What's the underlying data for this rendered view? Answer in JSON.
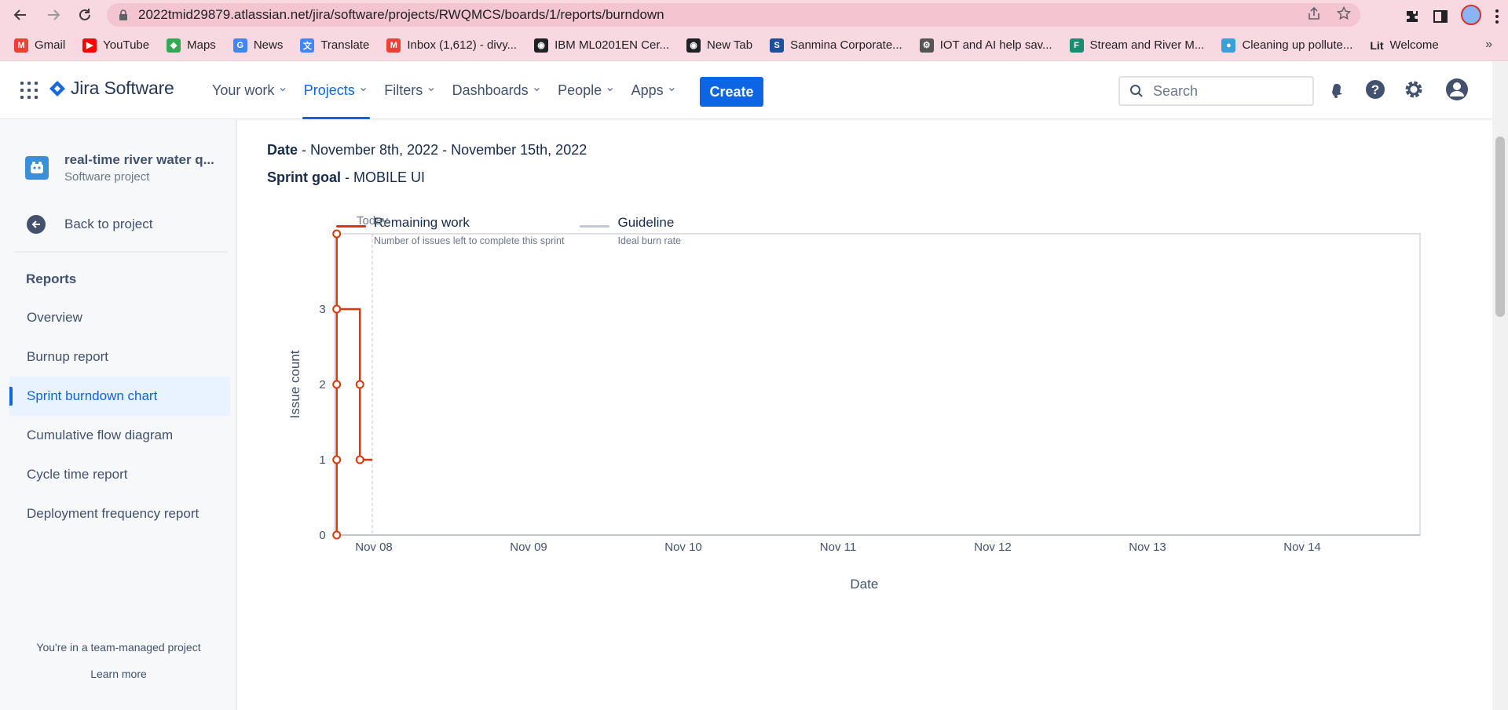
{
  "browser": {
    "url": "2022tmid29879.atlassian.net/jira/software/projects/RWQMCS/boards/1/reports/burndown",
    "bookmarks": [
      {
        "label": "Gmail",
        "color": "#ea4335",
        "glyph": "M"
      },
      {
        "label": "YouTube",
        "color": "#ff0000",
        "glyph": "▶"
      },
      {
        "label": "Maps",
        "color": "#34a853",
        "glyph": "◆"
      },
      {
        "label": "News",
        "color": "#4285f4",
        "glyph": "G"
      },
      {
        "label": "Translate",
        "color": "#4285f4",
        "glyph": "文"
      },
      {
        "label": "Inbox (1,612) - divy...",
        "color": "#ea4335",
        "glyph": "M"
      },
      {
        "label": "IBM ML0201EN Cer...",
        "color": "#202124",
        "glyph": "◉"
      },
      {
        "label": "New Tab",
        "color": "#202124",
        "glyph": "◉"
      },
      {
        "label": "Sanmina Corporate...",
        "color": "#1f4e9c",
        "glyph": "S"
      },
      {
        "label": "IOT and AI help sav...",
        "color": "#555555",
        "glyph": "⚙"
      },
      {
        "label": "Stream and River M...",
        "color": "#1a8c6f",
        "glyph": "F"
      },
      {
        "label": "Cleaning up pollute...",
        "color": "#3aa0d8",
        "glyph": "●"
      },
      {
        "label": "Welcome",
        "color": "#202124",
        "glyph": "Lit"
      }
    ]
  },
  "nav": {
    "product": "Jira Software",
    "menu": [
      {
        "label": "Your work",
        "active": false
      },
      {
        "label": "Projects",
        "active": true
      },
      {
        "label": "Filters",
        "active": false
      },
      {
        "label": "Dashboards",
        "active": false
      },
      {
        "label": "People",
        "active": false
      },
      {
        "label": "Apps",
        "active": false
      }
    ],
    "create_label": "Create",
    "search_placeholder": "Search"
  },
  "sidebar": {
    "project_name": "real-time river water q...",
    "project_type": "Software project",
    "back_label": "Back to project",
    "section_title": "Reports",
    "items": [
      {
        "label": "Overview",
        "active": false
      },
      {
        "label": "Burnup report",
        "active": false
      },
      {
        "label": "Sprint burndown chart",
        "active": true
      },
      {
        "label": "Cumulative flow diagram",
        "active": false
      },
      {
        "label": "Cycle time report",
        "active": false
      },
      {
        "label": "Deployment frequency report",
        "active": false
      }
    ],
    "team_note": "You're in a team-managed project",
    "learn_more": "Learn more"
  },
  "report": {
    "date_label": "Date",
    "date_value": "November 8th, 2022 - November 15th, 2022",
    "goal_label": "Sprint goal",
    "goal_value": "MOBILE UI"
  },
  "chart_data": {
    "type": "line",
    "legend": [
      {
        "name": "Remaining work",
        "description": "Number of issues left to complete this sprint",
        "color": "#de350b"
      },
      {
        "name": "Guideline",
        "description": "Ideal burn rate",
        "color": "#c1c7d0"
      }
    ],
    "today_label": "Today",
    "ylabel": "Issue count",
    "xlabel": "Date",
    "x_ticks": [
      "Nov 08",
      "Nov 09",
      "Nov 10",
      "Nov 11",
      "Nov 12",
      "Nov 13",
      "Nov 14"
    ],
    "y_ticks": [
      0,
      1,
      2,
      3
    ],
    "ylim": [
      0,
      4
    ],
    "xlim_days": [
      -0.25,
      6.75
    ],
    "today_day": 0.0,
    "series": [
      {
        "name": "Remaining work",
        "color": "#de350b",
        "points": [
          {
            "day": -0.23,
            "value": 0,
            "marker": true
          },
          {
            "day": -0.23,
            "value": 1,
            "marker": true
          },
          {
            "day": -0.23,
            "value": 2,
            "marker": true
          },
          {
            "day": -0.23,
            "value": 3,
            "marker": true
          },
          {
            "day": -0.23,
            "value": 4,
            "marker": true
          },
          {
            "day": -0.23,
            "value": 3,
            "marker": false
          },
          {
            "day": -0.08,
            "value": 3,
            "marker": false
          },
          {
            "day": -0.08,
            "value": 2,
            "marker": true
          },
          {
            "day": -0.08,
            "value": 1,
            "marker": true
          },
          {
            "day": 0.0,
            "value": 1,
            "marker": false
          }
        ]
      }
    ]
  }
}
